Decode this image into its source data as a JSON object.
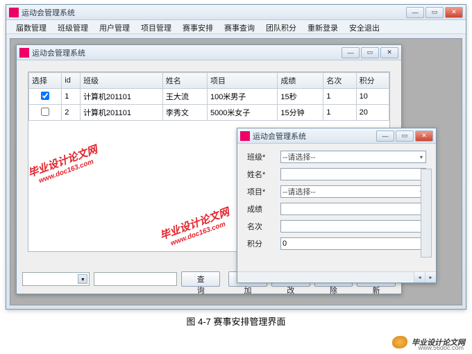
{
  "outer": {
    "title": "运动会管理系统",
    "menu": [
      "届数管理",
      "班级管理",
      "用户管理",
      "项目管理",
      "赛事安排",
      "赛事查询",
      "团队积分",
      "重新登录",
      "安全退出"
    ]
  },
  "child1": {
    "title": "运动会管理系统",
    "columns": [
      "选择",
      "id",
      "班级",
      "姓名",
      "项目",
      "成绩",
      "名次",
      "积分"
    ],
    "rows": [
      {
        "checked": true,
        "id": "1",
        "class": "计算机201101",
        "name": "王大流",
        "event": "100米男子",
        "score": "15秒",
        "rank": "1",
        "points": "10"
      },
      {
        "checked": false,
        "id": "2",
        "class": "计算机201101",
        "name": "李秀文",
        "event": "5000米女子",
        "score": "15分钟",
        "rank": "1",
        "points": "20"
      }
    ],
    "btn_query": "查询",
    "btn_add": "添加",
    "btn_edit": "修改",
    "btn_delete": "删除",
    "btn_refresh": "刷新"
  },
  "child2": {
    "title": "运动会管理系统",
    "labels": {
      "class": "班级*",
      "name": "姓名*",
      "event": "项目*",
      "score": "成绩",
      "rank": "名次",
      "points": "积分"
    },
    "placeholders": {
      "class": "--请选择--",
      "event": "--请选择--"
    },
    "values": {
      "name": "",
      "score": "",
      "rank": "",
      "points": "0"
    }
  },
  "caption": "图 4-7 赛事安排管理界面",
  "footer": {
    "brand": "毕业设计论文网",
    "url": "www.56doc.com"
  },
  "watermark": {
    "cn": "毕业设计论文网",
    "url": "www.doc163.com"
  }
}
